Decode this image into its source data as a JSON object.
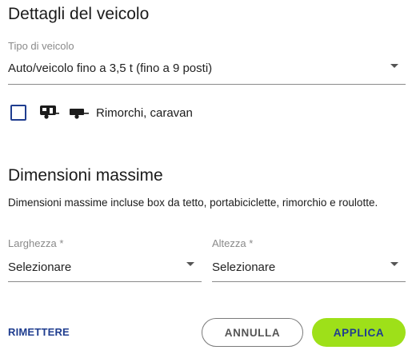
{
  "vehicle_details": {
    "title": "Dettagli del veicolo",
    "vehicle_type_label": "Tipo di veicolo",
    "vehicle_type_value": "Auto/veicolo fino a 3,5 t (fino a 9 posti)",
    "trailer_checkbox_label": "Rimorchi, caravan",
    "trailer_checked": false
  },
  "max_dimensions": {
    "title": "Dimensioni massime",
    "description": "Dimensioni massime incluse box da tetto, portabiciclette, rimorchio e roulotte.",
    "width_label": "Larghezza *",
    "width_value": "Selezionare",
    "height_label": "Altezza *",
    "height_value": "Selezionare"
  },
  "actions": {
    "reset_label": "RIMETTERE",
    "cancel_label": "ANNULLA",
    "apply_label": "APPLICA"
  },
  "colors": {
    "accent_blue": "#1f3d8f",
    "apply_green": "#9ee019"
  }
}
